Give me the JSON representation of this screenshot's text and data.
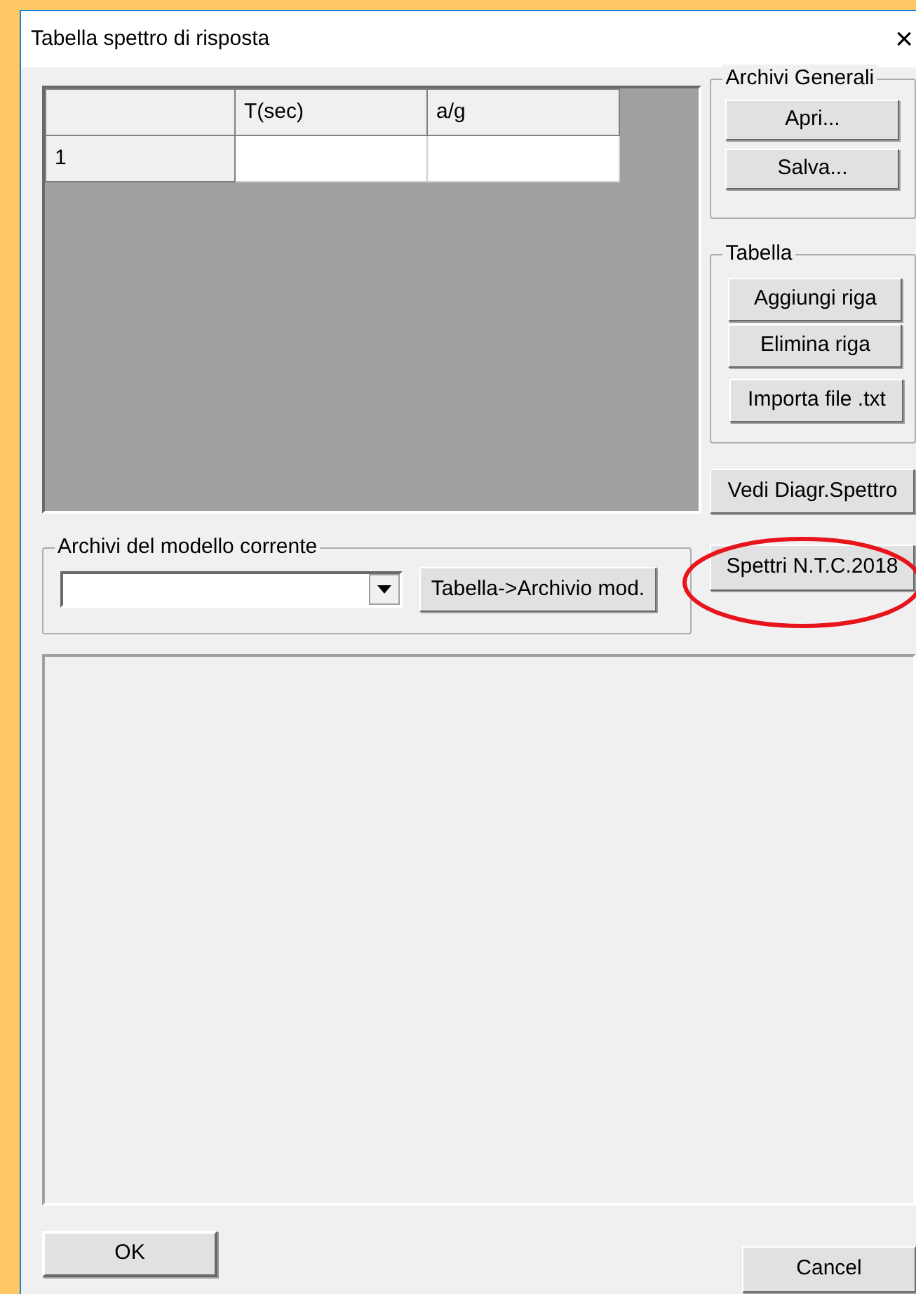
{
  "window": {
    "title": "Tabella spettro di risposta",
    "close": "×"
  },
  "table": {
    "columns": [
      "T(sec)",
      "a/g"
    ],
    "rows": [
      {
        "header": "1"
      }
    ]
  },
  "archivi_generali": {
    "title": "Archivi Generali",
    "buttons": [
      "Apri...",
      "Salva..."
    ]
  },
  "tabella": {
    "title": "Tabella",
    "buttons": [
      "Aggiungi riga",
      "Elimina riga",
      "Importa file .txt"
    ]
  },
  "diagram_button": "Vedi Diagr.Spettro",
  "archivi_modello": {
    "title": "Archivi del modello corrente",
    "button": "Tabella->Archivio mod."
  },
  "spectra_button": "Spettri N.T.C.2018",
  "buttons": {
    "ok": "OK",
    "cancel": "Cancel"
  }
}
